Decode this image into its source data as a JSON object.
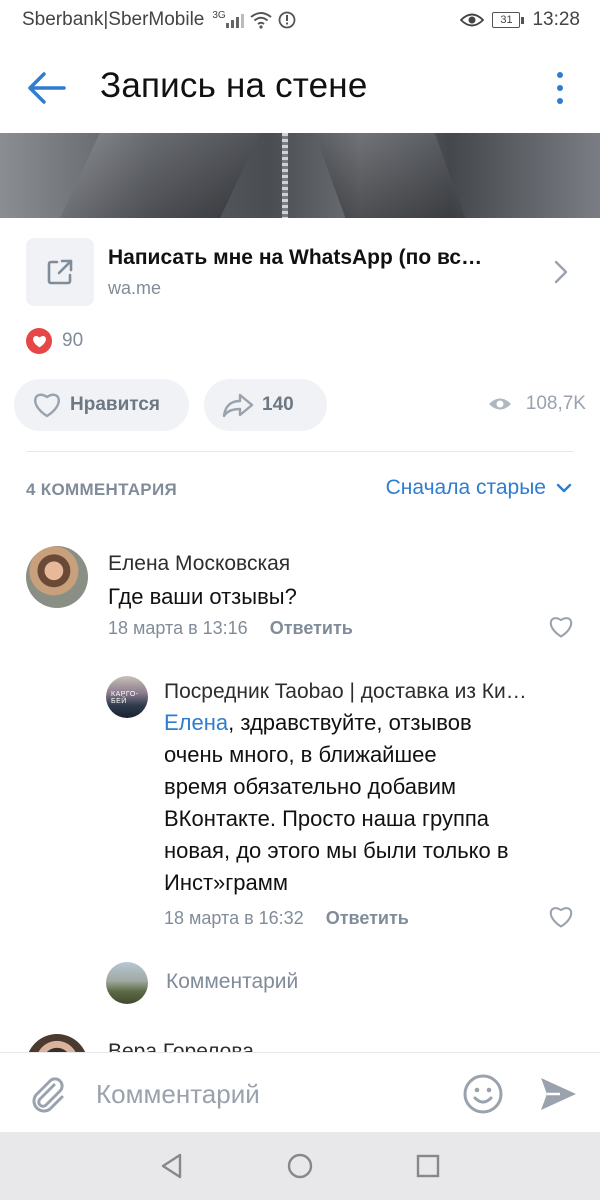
{
  "status_bar": {
    "carrier": "Sberbank|SberMobile",
    "network": "3G",
    "battery": "31",
    "time": "13:28"
  },
  "app_bar": {
    "title": "Запись на стене",
    "back_icon": "arrow-left-icon",
    "menu_icon": "more-vertical-icon"
  },
  "link_card": {
    "title": "Написать мне на WhatsApp (по вс…",
    "domain": "wa.me",
    "icon": "external-link-icon"
  },
  "reactions": {
    "count": "90"
  },
  "actions": {
    "like_label": "Нравится",
    "share_count": "140",
    "views": "108,7K"
  },
  "comments": {
    "header": "4 КОММЕНТАРИЯ",
    "sort_label": "Сначала старые",
    "items": [
      {
        "author": "Елена Московская",
        "text": "Где ваши отзывы?",
        "date": "18 марта в 13:16",
        "reply": "Ответить"
      },
      {
        "author": "Посредник Taobao | доставка из Ки…",
        "avatar_text": "КАРГО-БЕЙ",
        "mention": "Елена",
        "text_line1": ", здравствуйте, отзывов",
        "text_line2": "очень много, в ближайшее",
        "text_line3": "время обязательно добавим",
        "text_line4": "ВКонтакте. Просто наша группа",
        "text_line5": "новая, до этого мы были только в",
        "text_line6": "Инст»грамм",
        "date": "18 марта в 16:32",
        "reply": "Ответить"
      },
      {
        "author": "Вера Горелова"
      }
    ],
    "reply_placeholder": "Комментарий"
  },
  "composer": {
    "placeholder": "Комментарий"
  },
  "colors": {
    "accent": "#2f7cd0",
    "secondary_text": "#818c99",
    "like_red": "#e64646"
  }
}
